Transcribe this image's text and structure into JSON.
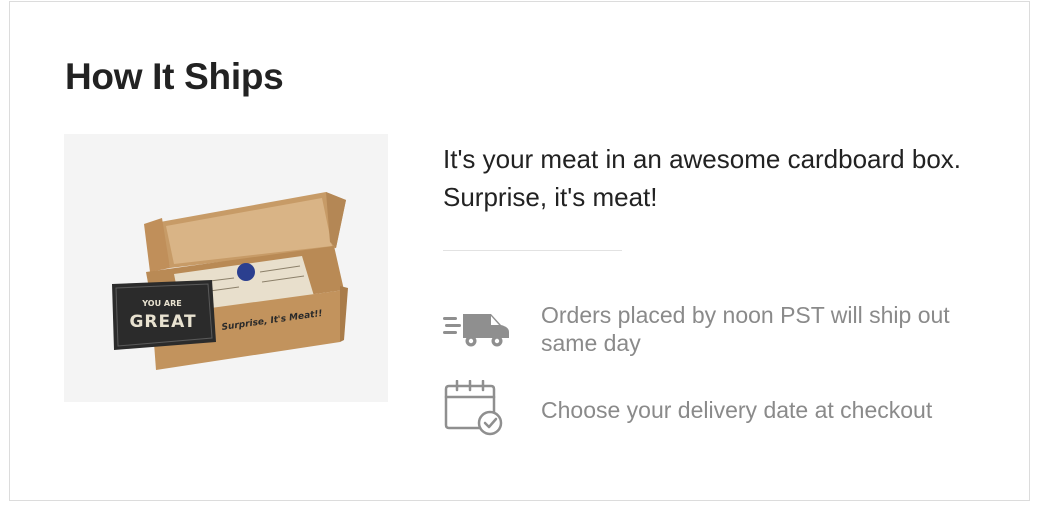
{
  "section": {
    "title": "How It Ships"
  },
  "product_image": {
    "card_small_text": "YOU ARE",
    "card_big_text": "GREAT",
    "box_text": "Surprise, It's Meat!!"
  },
  "description": "It's your meat in an awesome cardboard box. Surprise, it's meat!",
  "features": [
    {
      "icon": "delivery-truck-icon",
      "text": "Orders placed by noon PST will ship out same day"
    },
    {
      "icon": "calendar-check-icon",
      "text": "Choose your delivery date at checkout"
    }
  ],
  "colors": {
    "heading": "#222222",
    "muted_text": "#8a8a8a",
    "icon": "#8f8f8f",
    "border": "#dcdcdc",
    "image_bg": "#f4f4f4"
  }
}
